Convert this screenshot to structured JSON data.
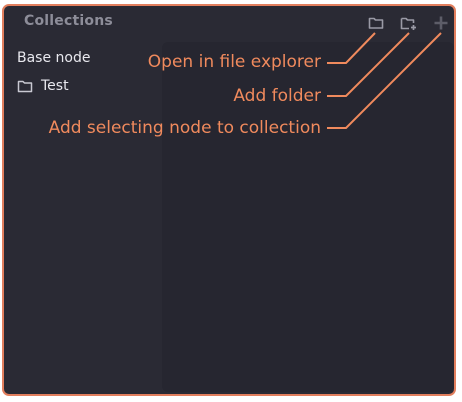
{
  "panel": {
    "title": "Collections",
    "header_buttons": [
      {
        "icon": "folder-open-icon",
        "tooltip": "Open in file explorer"
      },
      {
        "icon": "folder-add-icon",
        "tooltip": "Add folder"
      },
      {
        "icon": "plus-icon",
        "tooltip": "Add selecting node to collection"
      }
    ]
  },
  "tree": {
    "items": [
      {
        "label": "Base node",
        "type": "node"
      },
      {
        "label": "Test",
        "type": "folder",
        "icon": "folder-icon"
      }
    ]
  },
  "annotations": [
    "Open in file explorer",
    "Add folder",
    "Add selecting node to collection"
  ],
  "colors": {
    "accent": "#f08a5d",
    "border": "#e27f5e",
    "panel_bg": "#2a2a34",
    "content_bg": "#262630",
    "title": "#8d8d99",
    "text": "#e8e8ee"
  }
}
